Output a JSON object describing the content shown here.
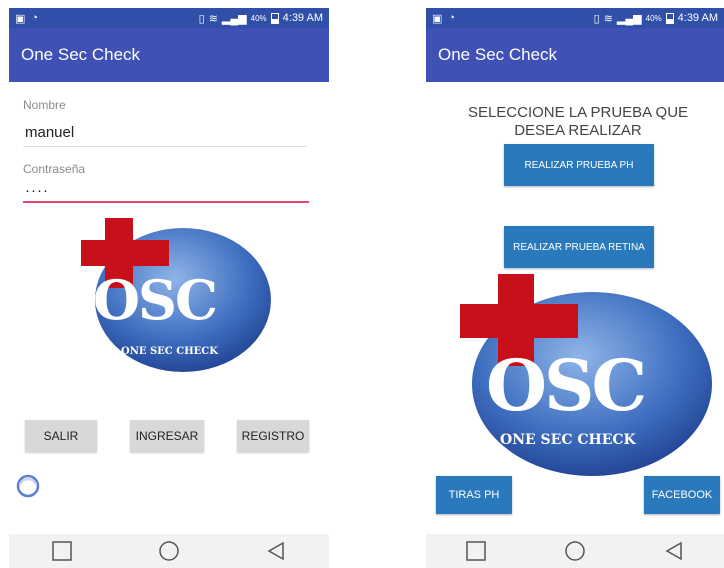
{
  "status_bar": {
    "time": "4:39 AM",
    "battery": "40%"
  },
  "left": {
    "app_title": "One Sec Check",
    "name_label": "Nombre",
    "name_value": "manuel",
    "password_label": "Contraseña",
    "password_value": "····",
    "buttons": {
      "exit": "SALIR",
      "login": "INGRESAR",
      "register": "REGISTRO"
    },
    "logo_text": "OSC",
    "logo_subtitle": "ONE SEC CHECK"
  },
  "right": {
    "app_title": "One Sec Check",
    "prompt_line1": "SELECCIONE LA PRUEBA QUE",
    "prompt_line2": "DESEA REALIZAR",
    "buttons": {
      "ph_test": "REALIZAR PRUEBA PH",
      "retina_test": "REALIZAR PRUEBA RETINA",
      "ph_strips": "TIRAS PH",
      "facebook": "FACEBOOK"
    },
    "logo_text": "OSC",
    "logo_subtitle": "ONE SEC CHECK"
  },
  "nav": {
    "recent_icon": "square-icon",
    "home_icon": "circle-icon",
    "back_icon": "triangle-back-icon"
  },
  "colors": {
    "app_bar": "#3f51b5",
    "status_bar": "#2f4fa8",
    "accent": "#e2456d",
    "action_button": "#2a79bd",
    "cross": "#c8101b"
  }
}
